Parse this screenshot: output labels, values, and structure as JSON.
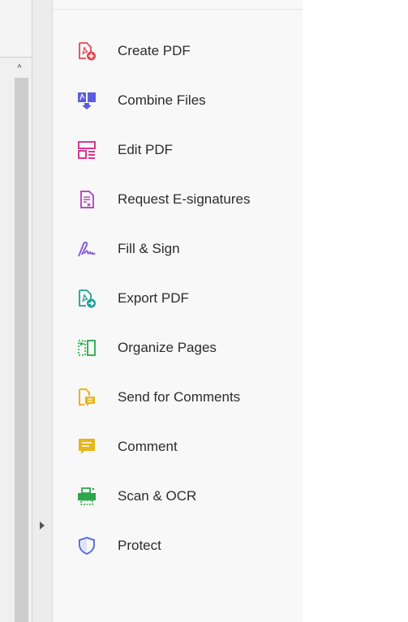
{
  "tools_pane": {
    "items": [
      {
        "label": "Create PDF",
        "icon": "create-pdf-icon",
        "color": "#e34850"
      },
      {
        "label": "Combine Files",
        "icon": "combine-files-icon",
        "color": "#5c5ce0"
      },
      {
        "label": "Edit PDF",
        "icon": "edit-pdf-icon",
        "color": "#d83790"
      },
      {
        "label": "Request E-signatures",
        "icon": "request-esignatures-icon",
        "color": "#b84fc4"
      },
      {
        "label": "Fill & Sign",
        "icon": "fill-sign-icon",
        "color": "#8a5fd6"
      },
      {
        "label": "Export PDF",
        "icon": "export-pdf-icon",
        "color": "#20a09a"
      },
      {
        "label": "Organize Pages",
        "icon": "organize-pages-icon",
        "color": "#38b25a"
      },
      {
        "label": "Send for Comments",
        "icon": "send-for-comments-icon",
        "color": "#e8b51a"
      },
      {
        "label": "Comment",
        "icon": "comment-icon",
        "color": "#e8b51a"
      },
      {
        "label": "Scan & OCR",
        "icon": "scan-ocr-icon",
        "color": "#2aa84a"
      },
      {
        "label": "Protect",
        "icon": "protect-icon",
        "color": "#5a6ed8"
      }
    ]
  }
}
